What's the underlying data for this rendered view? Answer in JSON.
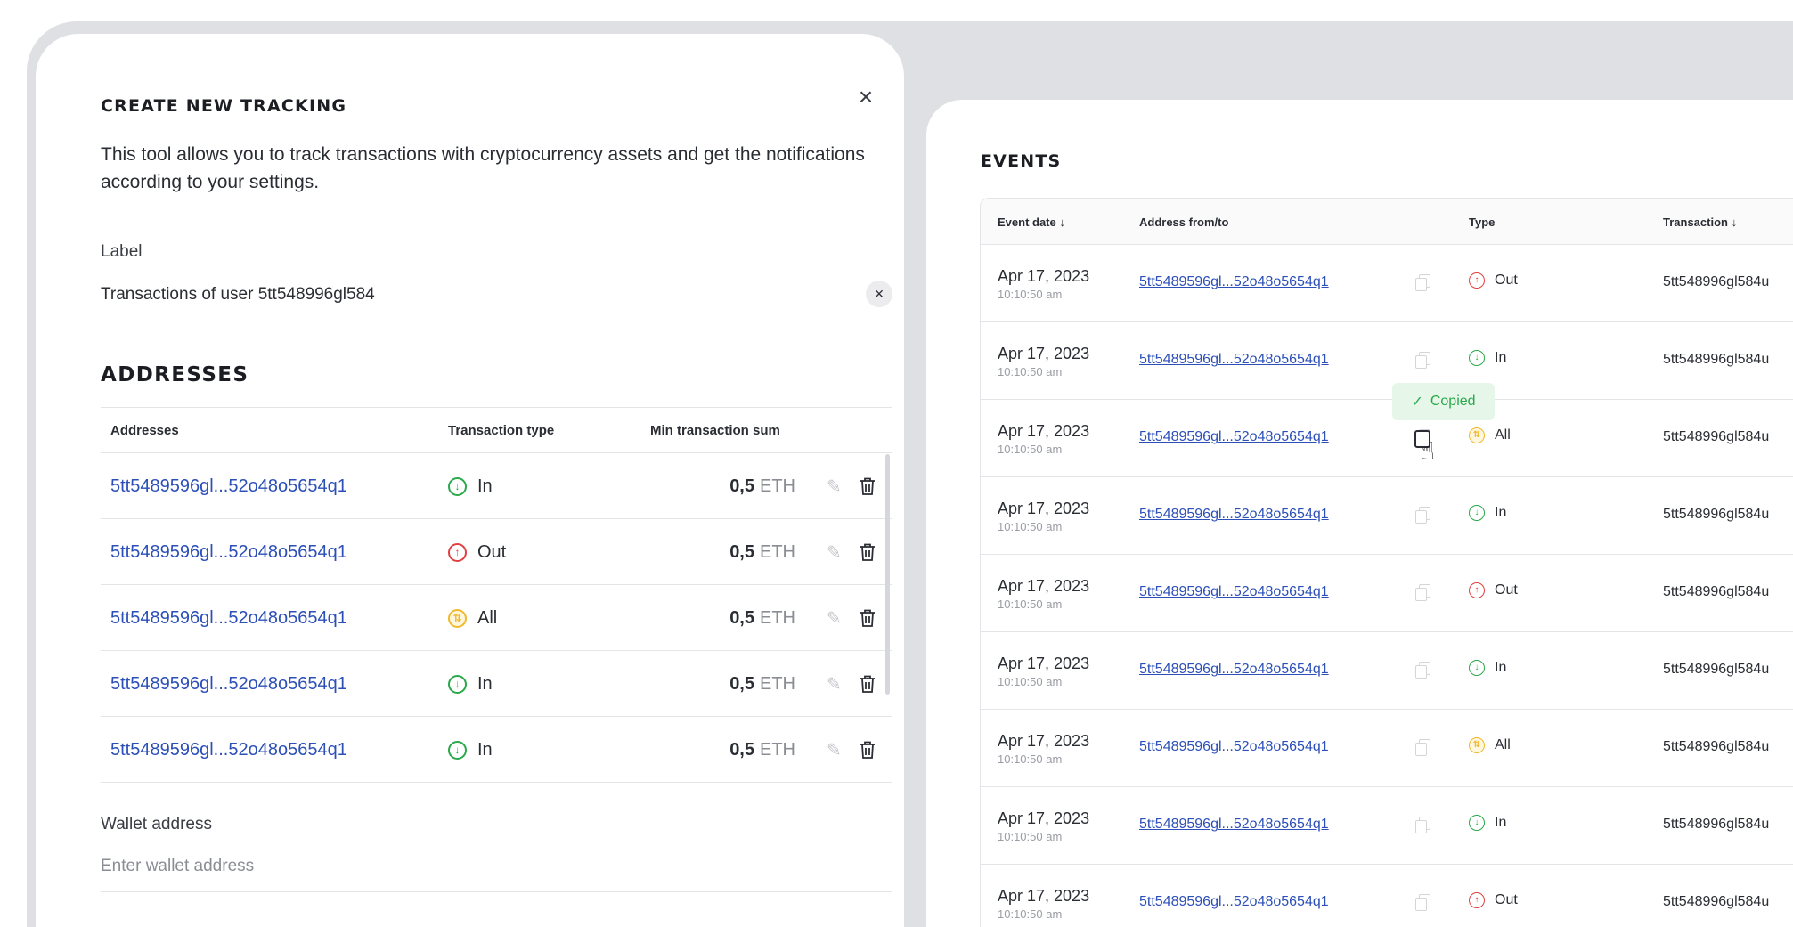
{
  "modal": {
    "title": "CREATE NEW TRACKING",
    "close_icon": "×",
    "description": "This tool allows you to track transactions with cryptocurrency assets and get the notifications according to your settings.",
    "label_field": {
      "label": "Label",
      "value": "Transactions of user 5tt548996gl584",
      "clear_icon": "×"
    },
    "addresses_title": "ADDRESSES",
    "addresses_table": {
      "headers": [
        "Addresses",
        "Transaction type",
        "Min transaction sum"
      ],
      "rows": [
        {
          "address": "5tt5489596gl...52o48o5654q1",
          "type": "In",
          "icon": "arrow-down-circle-icon",
          "amount": "0,5",
          "currency": "ETH"
        },
        {
          "address": "5tt5489596gl...52o48o5654q1",
          "type": "Out",
          "icon": "arrow-up-circle-icon",
          "amount": "0,5",
          "currency": "ETH"
        },
        {
          "address": "5tt5489596gl...52o48o5654q1",
          "type": "All",
          "icon": "swap-circle-icon",
          "amount": "0,5",
          "currency": "ETH"
        },
        {
          "address": "5tt5489596gl...52o48o5654q1",
          "type": "In",
          "icon": "arrow-down-circle-icon",
          "amount": "0,5",
          "currency": "ETH"
        },
        {
          "address": "5tt5489596gl...52o48o5654q1",
          "type": "In",
          "icon": "arrow-down-circle-icon",
          "amount": "0,5",
          "currency": "ETH"
        }
      ]
    },
    "wallet_field": {
      "label": "Wallet address",
      "placeholder": "Enter wallet address"
    }
  },
  "events": {
    "title": "EVENTS",
    "headers": [
      "Event date ↓",
      "Address from/to",
      "Type",
      "Transaction ↓"
    ],
    "tooltip": "Copied",
    "rows": [
      {
        "date": "Apr 17, 2023",
        "time": "10:10:50 am",
        "address": "5tt5489596gl...52o48o5654q1",
        "type": "Out",
        "tx": "5tt548996gl584u"
      },
      {
        "date": "Apr 17, 2023",
        "time": "10:10:50 am",
        "address": "5tt5489596gl...52o48o5654q1",
        "type": "In",
        "tx": "5tt548996gl584u"
      },
      {
        "date": "Apr 17, 2023",
        "time": "10:10:50 am",
        "address": "5tt5489596gl...52o48o5654q1",
        "type": "All",
        "tx": "5tt548996gl584u"
      },
      {
        "date": "Apr 17, 2023",
        "time": "10:10:50 am",
        "address": "5tt5489596gl...52o48o5654q1",
        "type": "In",
        "tx": "5tt548996gl584u"
      },
      {
        "date": "Apr 17, 2023",
        "time": "10:10:50 am",
        "address": "5tt5489596gl...52o48o5654q1",
        "type": "Out",
        "tx": "5tt548996gl584u"
      },
      {
        "date": "Apr 17, 2023",
        "time": "10:10:50 am",
        "address": "5tt5489596gl...52o48o5654q1",
        "type": "In",
        "tx": "5tt548996gl584u"
      },
      {
        "date": "Apr 17, 2023",
        "time": "10:10:50 am",
        "address": "5tt5489596gl...52o48o5654q1",
        "type": "All",
        "tx": "5tt548996gl584u"
      },
      {
        "date": "Apr 17, 2023",
        "time": "10:10:50 am",
        "address": "5tt5489596gl...52o48o5654q1",
        "type": "In",
        "tx": "5tt548996gl584u"
      },
      {
        "date": "Apr 17, 2023",
        "time": "10:10:50 am",
        "address": "5tt5489596gl...52o48o5654q1",
        "type": "Out",
        "tx": "5tt548996gl584u"
      }
    ]
  },
  "colors": {
    "link": "#2c4fb8",
    "in": "#2aa84a",
    "out": "#e04040",
    "all": "#f0b92e",
    "background": "#dfe0e3"
  }
}
